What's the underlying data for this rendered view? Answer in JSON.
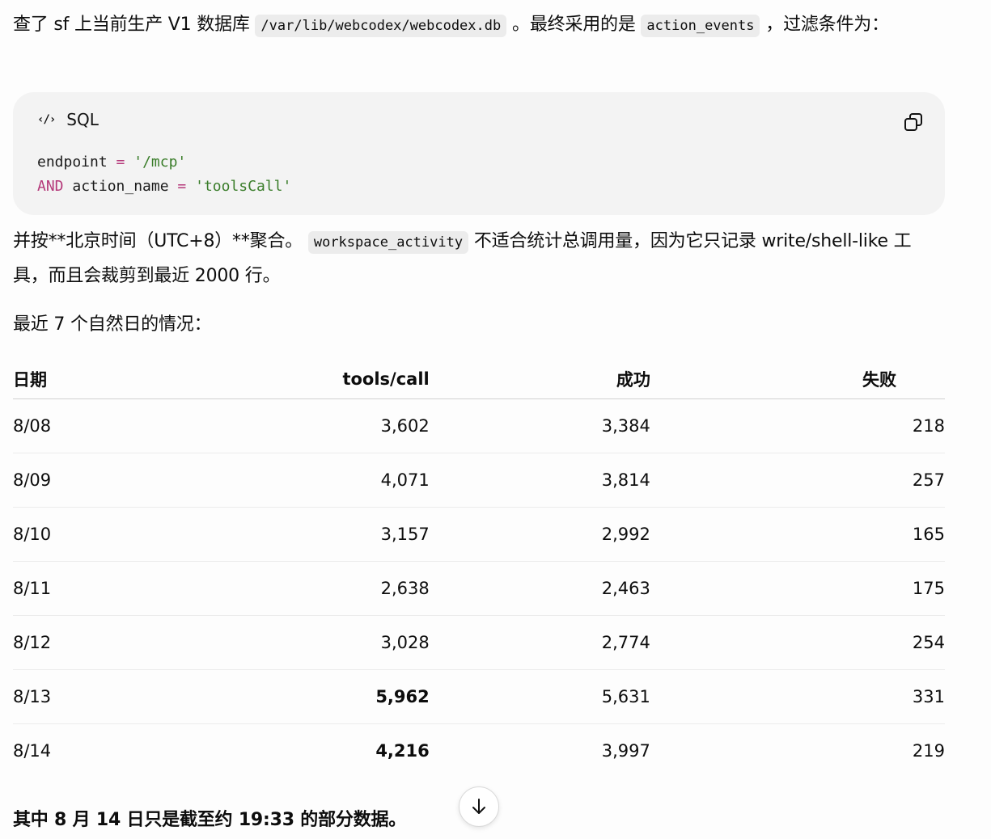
{
  "intro": {
    "text_a": "查了 sf 上当前生产 V1 数据库 ",
    "db_path": "/var/lib/webcodex/webcodex.db",
    "text_b": " 。最终采用的是 ",
    "table_name": "action_events",
    "text_c": " ，过滤条件为："
  },
  "code_block": {
    "language": "SQL",
    "line1": {
      "ident": "endpoint",
      "op": "=",
      "value": "'/mcp'"
    },
    "line2": {
      "kw": "AND",
      "ident": "action_name",
      "op": "=",
      "value": "'toolsCall'"
    }
  },
  "note": {
    "text_a": "并按**北京时间（UTC+8）**聚合。",
    "table_name": "workspace_activity",
    "text_b": " 不适合统计总调用量，因为它只记录 write/shell-like 工具，而且会裁剪到最近 2000 行。"
  },
  "summary_lead": "最近 7 个自然日的情况：",
  "table": {
    "headers": [
      "日期",
      "tools/call",
      "成功",
      "失败"
    ],
    "rows": [
      [
        "8/08",
        "3,602",
        "3,384",
        "218"
      ],
      [
        "8/09",
        "4,071",
        "3,814",
        "257"
      ],
      [
        "8/10",
        "3,157",
        "2,992",
        "165"
      ],
      [
        "8/11",
        "2,638",
        "2,463",
        "175"
      ],
      [
        "8/12",
        "3,028",
        "2,774",
        "254"
      ],
      [
        "8/13",
        "5,962",
        "5,631",
        "331"
      ],
      [
        "8/14",
        "4,216",
        "3,997",
        "219"
      ]
    ],
    "bold_calls_rows": [
      5,
      6
    ]
  },
  "footnote": "其中 8 月 14 日只是截至约 19:33 的部分数据。",
  "icons": {
    "code": "code-icon",
    "copy": "copy-icon",
    "scroll": "arrow-down-icon"
  }
}
